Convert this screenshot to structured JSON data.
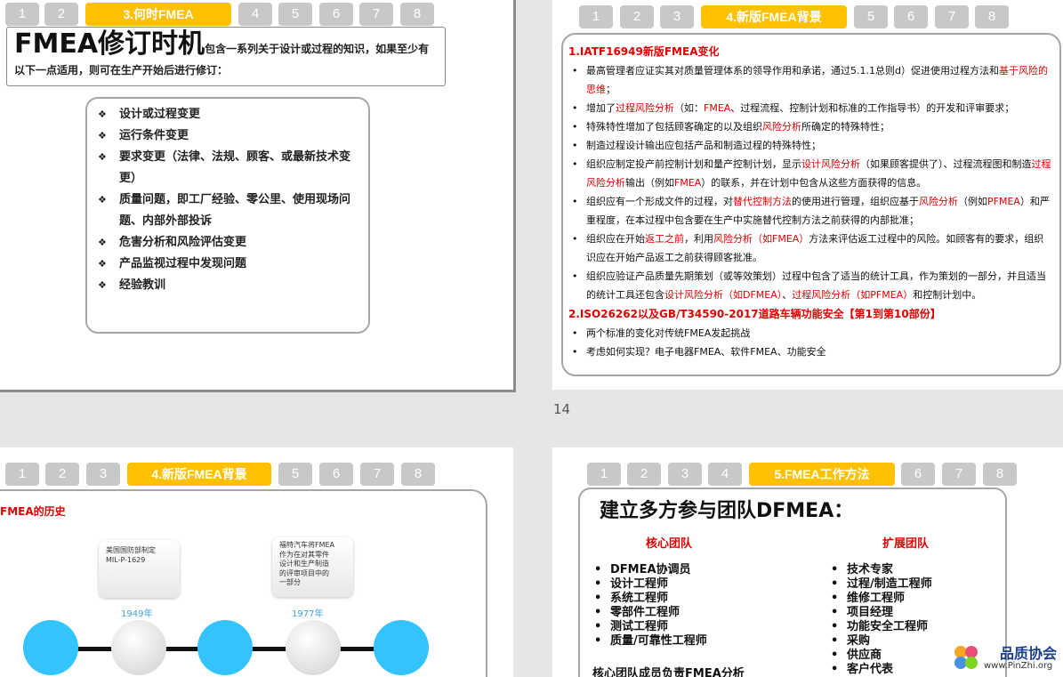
{
  "page_number": "14",
  "slide1": {
    "tabs": [
      "1",
      "2",
      "3.何时FMEA",
      "4",
      "5",
      "6",
      "7",
      "8"
    ],
    "title_big": "FMEA修订时机",
    "title_rest": "包含一系列关于设计或过程的知识，如果至少有以下一点适用，则可在生产开始后进行修订：",
    "items": [
      "设计或过程变更",
      "运行条件变更",
      "要求变更（法律、法规、顾客、或最新技术变更）",
      "质量问题，即工厂经验、零公里、使用现场问题、内部外部投诉",
      "危害分析和风险评估变更",
      "产品监视过程中发现问题",
      "经验教训"
    ]
  },
  "slide2": {
    "tabs": [
      "1",
      "2",
      "3",
      "4.新版FMEA背景",
      "5",
      "6",
      "7",
      "8"
    ],
    "h1": "1.IATF16949新版FMEA变化",
    "b1": {
      "t1": "最高管理者应证实其对质量管理体系的领导作用和承诺，通过5.1.1总则d）促进使用过程方法和",
      "r1": "基于风险的思维",
      "t2": "；"
    },
    "b2": {
      "t1": "增加了",
      "r1": "过程风险分析",
      "t2": "（如：",
      "r2": "FMEA",
      "t3": "、过程流程、控制计划和标准的工作指导书）的开发和评审要求；"
    },
    "b3": {
      "t1": "特殊特性增加了包括顾客确定的以及组织",
      "r1": "风险分析",
      "t2": "所确定的特殊特性；"
    },
    "b4": {
      "t1": "制造过程设计输出应包括产品和制造过程的特殊特性；"
    },
    "b5": {
      "t1": "组织应制定投产前控制计划和量产控制计划，显示",
      "r1": "设计风险分析",
      "t2": "（如果顾客提供了）、过程流程图和制造",
      "r2": "过程风险分析",
      "t3": "输出（例如",
      "r3": "FMEA",
      "t4": "）的联系，并在计划中包含从这些方面获得的信息。"
    },
    "b6": {
      "t1": "组织应有一个形成文件的过程，对",
      "r1": "替代控制方法",
      "t2": "的使用进行管理，组织应基于",
      "r2": "风险分析",
      "t3": "（例如",
      "r3": "PFMEA",
      "t4": "）和严重程度，在本过程中包含要在生产中实施替代控制方法之前获得的内部批准；"
    },
    "b7": {
      "t1": "组织应在开始",
      "r1": "返工之前",
      "t2": "，利用",
      "r2": "风险分析（如FMEA）",
      "t3": "方法来评估返工过程中的风险。如顾客有的要求，组织识应在开始产品返工之前获得顾客批准。"
    },
    "b8": {
      "t1": "组织应验证产品质量先期策划（或等效策划）过程中包含了适当的统计工具，作为策划的一部分，并且适当的统计工具还包含",
      "r1": "设计风险分析（如DFMEA）",
      "t2": "、",
      "r2": "过程风险分析（如PFMEA）",
      "t3": "和控制计划中。"
    },
    "h2": "2.ISO26262以及GB/T34590-2017道路车辆功能安全【第1到第10部份】",
    "b9": "两个标准的变化对传统FMEA发起挑战",
    "b10": "考虑如何实现？电子电器FMEA、软件FMEA、功能安全"
  },
  "slide3": {
    "tabs": [
      "1",
      "2",
      "3",
      "4.新版FMEA背景",
      "5",
      "6",
      "7",
      "8"
    ],
    "heading": "FMEA的历史",
    "note1": [
      "美国国防部制定",
      "MIL-P-1629"
    ],
    "note2": [
      "福特汽车将FMEA",
      "作为在对其零件",
      "设计和生产制造",
      "的评审项目中的",
      "一部分"
    ],
    "year1": "1949年",
    "year2": "1977年",
    "colors": {
      "blue": "#33c4ff",
      "grey": "#d8d8d8",
      "line": "#111111"
    }
  },
  "slide4": {
    "tabs": [
      "1",
      "2",
      "3",
      "4",
      "5.FMEA工作方法",
      "6",
      "7",
      "8"
    ],
    "title": "建立多方参与团队DFMEA：",
    "core_label": "核心团队",
    "ext_label": "扩展团队",
    "core": [
      "DFMEA协调员",
      "设计工程师",
      "系统工程师",
      "零部件工程师",
      "测试工程师",
      "质量/可靠性工程师"
    ],
    "ext": [
      "技术专家",
      "过程/制造工程师",
      "维修工程师",
      "项目经理",
      "功能安全工程师",
      "采购",
      "供应商",
      "客户代表"
    ],
    "footer": "核心团队成员负责FMEA分析"
  },
  "watermark": {
    "brand": "品质协会",
    "url": "www.PinZhi.org"
  }
}
